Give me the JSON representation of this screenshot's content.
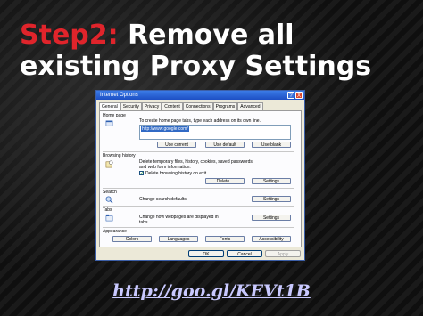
{
  "slide": {
    "title_accent": "Step2:",
    "title_rest": " Remove all existing Proxy Settings",
    "link": "http://goo.gl/KEVt1B"
  },
  "dialog": {
    "title": "Internet Options",
    "help_glyph": "?",
    "close_glyph": "X",
    "tabs": [
      "General",
      "Security",
      "Privacy",
      "Content",
      "Connections",
      "Programs",
      "Advanced"
    ],
    "home_page": {
      "label": "Home page",
      "description": "To create home page tabs, type each address on its own line.",
      "address": "http://www.google.com/",
      "buttons": [
        "Use current",
        "Use default",
        "Use blank"
      ]
    },
    "browsing_history": {
      "label": "Browsing history",
      "description_line1": "Delete temporary files, history, cookies, saved passwords,",
      "description_line2": "and web form information.",
      "checkbox_label": "Delete browsing history on exit",
      "buttons": [
        "Delete...",
        "Settings"
      ]
    },
    "search": {
      "label": "Search",
      "description": "Change search defaults.",
      "button": "Settings"
    },
    "tabs_section": {
      "label": "Tabs",
      "description_line1": "Change how webpages are displayed in",
      "description_line2": "tabs.",
      "button": "Settings"
    },
    "appearance": {
      "label": "Appearance",
      "buttons": [
        "Colors",
        "Languages",
        "Fonts",
        "Accessibility"
      ]
    },
    "footer_buttons": [
      "OK",
      "Cancel",
      "Apply"
    ]
  },
  "colors": {
    "accent_red": "#e0242b",
    "link": "#c9c9ff",
    "xp_titlebar": "#1d4fc4"
  }
}
